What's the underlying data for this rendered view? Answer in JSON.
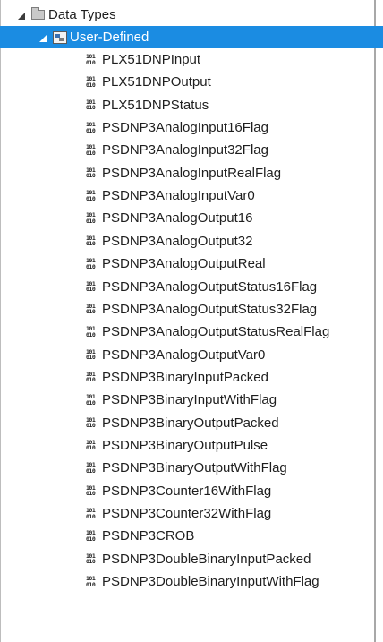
{
  "tree": {
    "root_label": "Data Types",
    "group_label": "User-Defined",
    "items": [
      "PLX51DNPInput",
      "PLX51DNPOutput",
      "PLX51DNPStatus",
      "PSDNP3AnalogInput16Flag",
      "PSDNP3AnalogInput32Flag",
      "PSDNP3AnalogInputRealFlag",
      "PSDNP3AnalogInputVar0",
      "PSDNP3AnalogOutput16",
      "PSDNP3AnalogOutput32",
      "PSDNP3AnalogOutputReal",
      "PSDNP3AnalogOutputStatus16Flag",
      "PSDNP3AnalogOutputStatus32Flag",
      "PSDNP3AnalogOutputStatusRealFlag",
      "PSDNP3AnalogOutputVar0",
      "PSDNP3BinaryInputPacked",
      "PSDNP3BinaryInputWithFlag",
      "PSDNP3BinaryOutputPacked",
      "PSDNP3BinaryOutputPulse",
      "PSDNP3BinaryOutputWithFlag",
      "PSDNP3Counter16WithFlag",
      "PSDNP3Counter32WithFlag",
      "PSDNP3CROB",
      "PSDNP3DoubleBinaryInputPacked",
      "PSDNP3DoubleBinaryInputWithFlag"
    ],
    "item_icon_glyph_top": "101",
    "item_icon_glyph_bottom": "010",
    "selected_color": "#1b8ce2"
  }
}
